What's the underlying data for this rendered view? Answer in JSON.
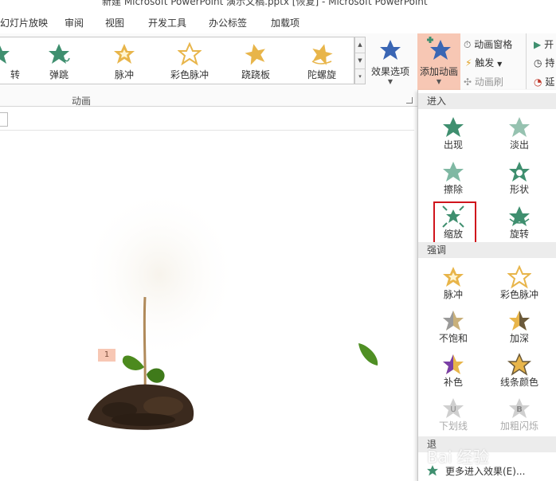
{
  "window": {
    "title": "新建 Microsoft PowerPoint 演示文稿.pptx [恢复] - Microsoft PowerPoint"
  },
  "tabs": [
    "幻灯片放映",
    "审阅",
    "视图",
    "开发工具",
    "办公标签",
    "加载项"
  ],
  "ribbon": {
    "gallery": [
      "转",
      "弹跳",
      "脉冲",
      "彩色脉冲",
      "跷跷板",
      "陀螺旋"
    ],
    "effect_options": "效果选项",
    "add_animation": "添加动画",
    "anim_pane": "动画窗格",
    "trigger": "触发",
    "anim_painter": "动画刷",
    "start": "开",
    "duration": "持",
    "delay": "延",
    "group_label": "动画"
  },
  "slide": {
    "badge": "1"
  },
  "dropdown": {
    "sections": {
      "entrance": "进入",
      "emphasis": "强调",
      "exit": "退"
    },
    "entrance": [
      "出现",
      "淡出",
      "擦除",
      "形状",
      "缩放",
      "旋转"
    ],
    "emphasis": [
      "脉冲",
      "彩色脉冲",
      "不饱和",
      "加深",
      "补色",
      "线条颜色",
      "下划线",
      "加粗闪烁"
    ],
    "more_link": "更多进入效果(E)...",
    "selected": "缩放"
  },
  "watermark": "Bai 经验",
  "colors": {
    "entrance_green": "#3f8f6f",
    "emphasis_gold": "#e8b54a",
    "highlight_red": "#d0141c",
    "ribbon_accent": "#f7c7b4"
  }
}
